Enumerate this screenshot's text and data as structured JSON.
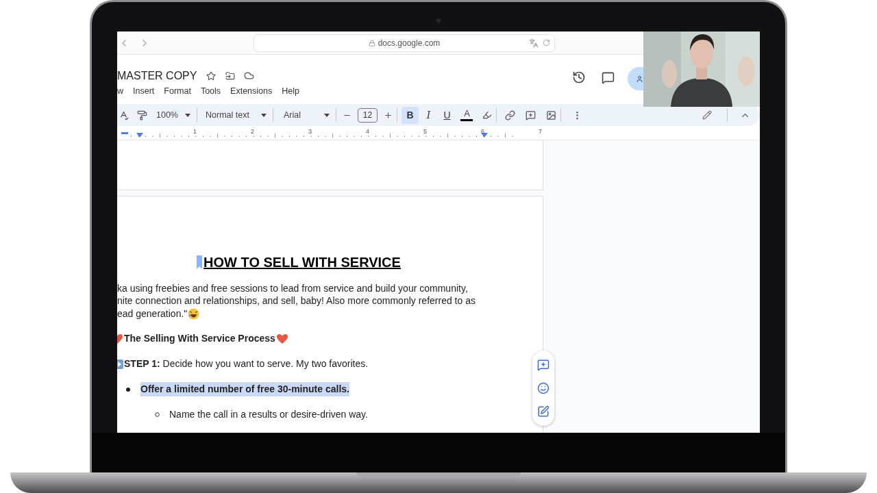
{
  "browser": {
    "url": "docs.google.com"
  },
  "document": {
    "title": "MASTER COPY"
  },
  "menu": [
    "w",
    "Insert",
    "Format",
    "Tools",
    "Extensions",
    "Help"
  ],
  "toolbar": {
    "zoom": "100%",
    "style": "Normal text",
    "font": "Arial",
    "font_size": "12",
    "format_buttons": [
      {
        "label": "B",
        "selected": true,
        "kind": "bold"
      },
      {
        "label": "I",
        "selected": false,
        "kind": "italic"
      },
      {
        "label": "U",
        "selected": false,
        "kind": "underline"
      }
    ],
    "text_color": {
      "label": "A",
      "color": "#000000"
    }
  },
  "ruler": [
    "1",
    "2",
    "3",
    "4",
    "5",
    "6",
    "7"
  ],
  "content": [
    {
      "kind": "heading",
      "text": "HOW TO SELL WITH SERVICE"
    },
    {
      "kind": "paragraph",
      "lines": [
        "ka using freebies and free sessions to lead from service and build your community,",
        "nite connection and relationships, and sell, baby! Also more commonly referred to as",
        "ead generation.\""
      ]
    },
    {
      "kind": "subheading",
      "text": "The Selling With Service Process"
    },
    {
      "kind": "step",
      "text": "**STEP 1:** Decide how you want to serve. My two favorites."
    },
    {
      "kind": "bullet",
      "text": "Offer a limited number of free 30-minute calls.",
      "selected": true,
      "children": [
        {
          "kind": "bullet",
          "text": "Name the call in a results or desire-driven way.",
          "selected": false
        }
      ]
    }
  ]
}
